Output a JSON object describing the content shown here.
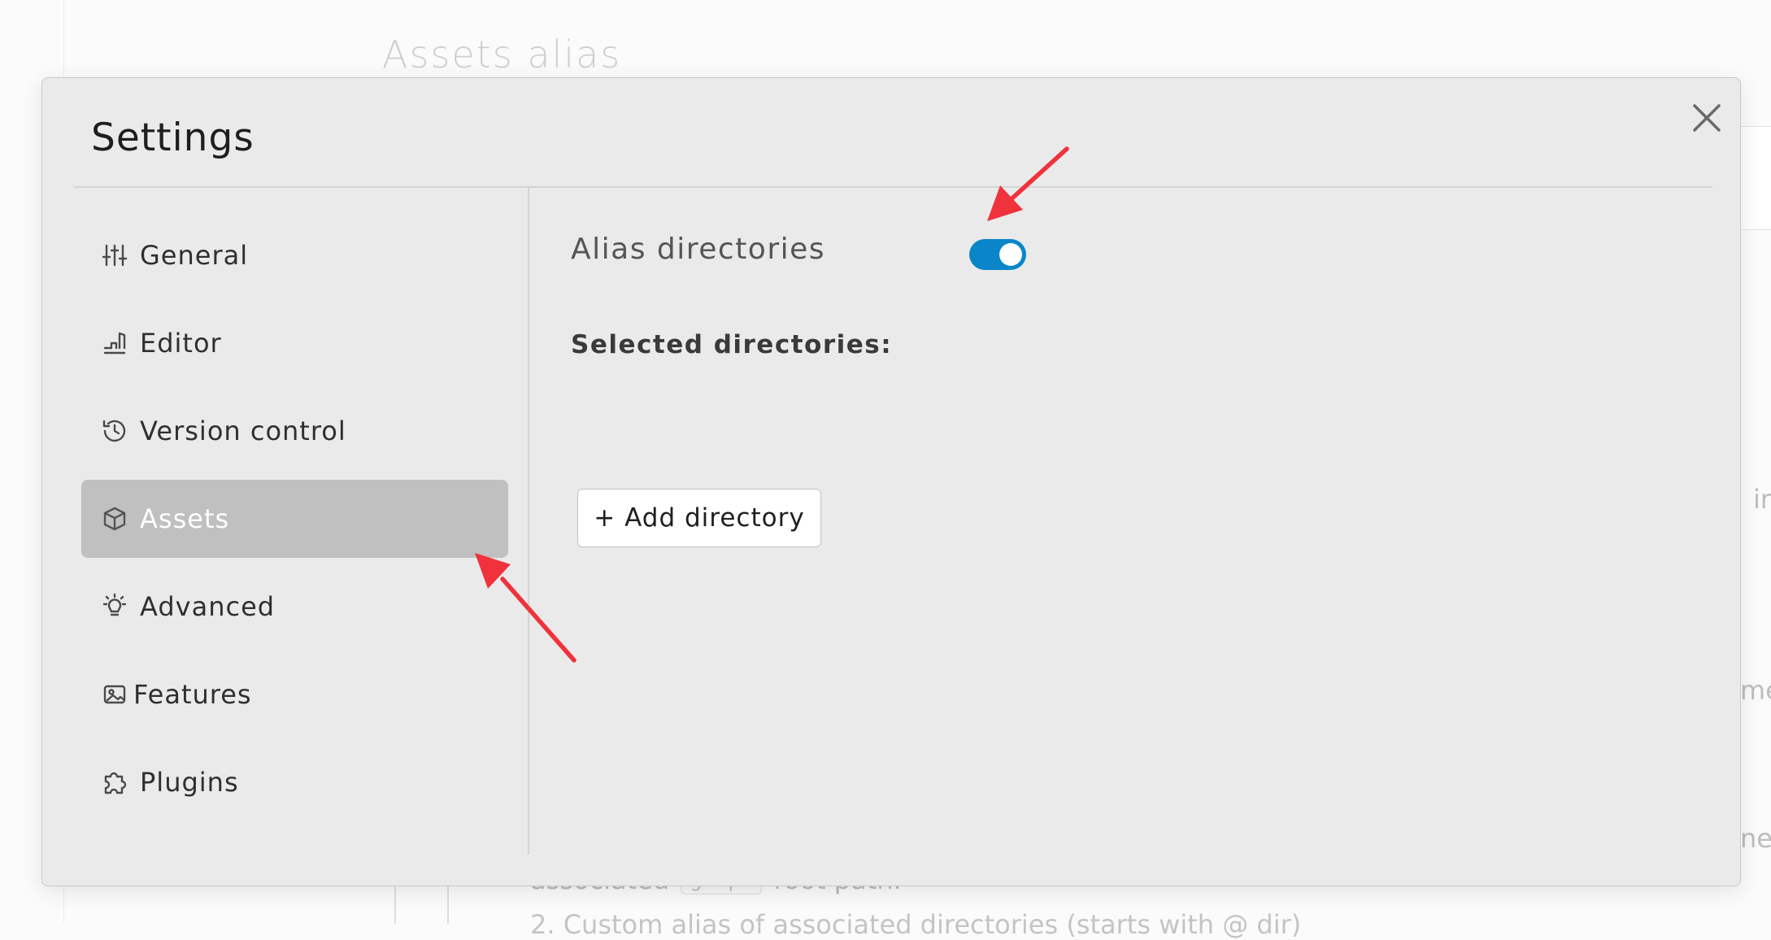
{
  "background": {
    "page_title": "Assets alias",
    "fragment_right_1": "ir",
    "fragment_right_2": "me",
    "fragment_right_3": "ne",
    "bottom_text_before": "associated",
    "bottom_code": "graph",
    "bottom_text_after": "root path.",
    "bottom_text_line2": "2. Custom alias of associated directories (starts with @ dir)"
  },
  "modal": {
    "title": "Settings",
    "close_icon": "close-icon"
  },
  "sidebar": {
    "items": [
      {
        "label": "General",
        "icon": "sliders-icon",
        "active": false
      },
      {
        "label": "Editor",
        "icon": "editor-icon",
        "active": false
      },
      {
        "label": "Version control",
        "icon": "history-icon",
        "active": false
      },
      {
        "label": "Assets",
        "icon": "cube-icon",
        "active": true
      },
      {
        "label": "Advanced",
        "icon": "lightbulb-icon",
        "active": false
      },
      {
        "label": "Features",
        "icon": "image-icon",
        "active": false
      },
      {
        "label": "Plugins",
        "icon": "puzzle-icon",
        "active": false
      }
    ]
  },
  "content": {
    "alias_label": "Alias directories",
    "alias_toggle_on": true,
    "selected_label": "Selected directories:",
    "add_button_label": "+ Add directory"
  },
  "colors": {
    "toggle_on": "#0a85c9",
    "active_nav_bg": "#c0c0c0",
    "arrow": "#f0323c"
  }
}
